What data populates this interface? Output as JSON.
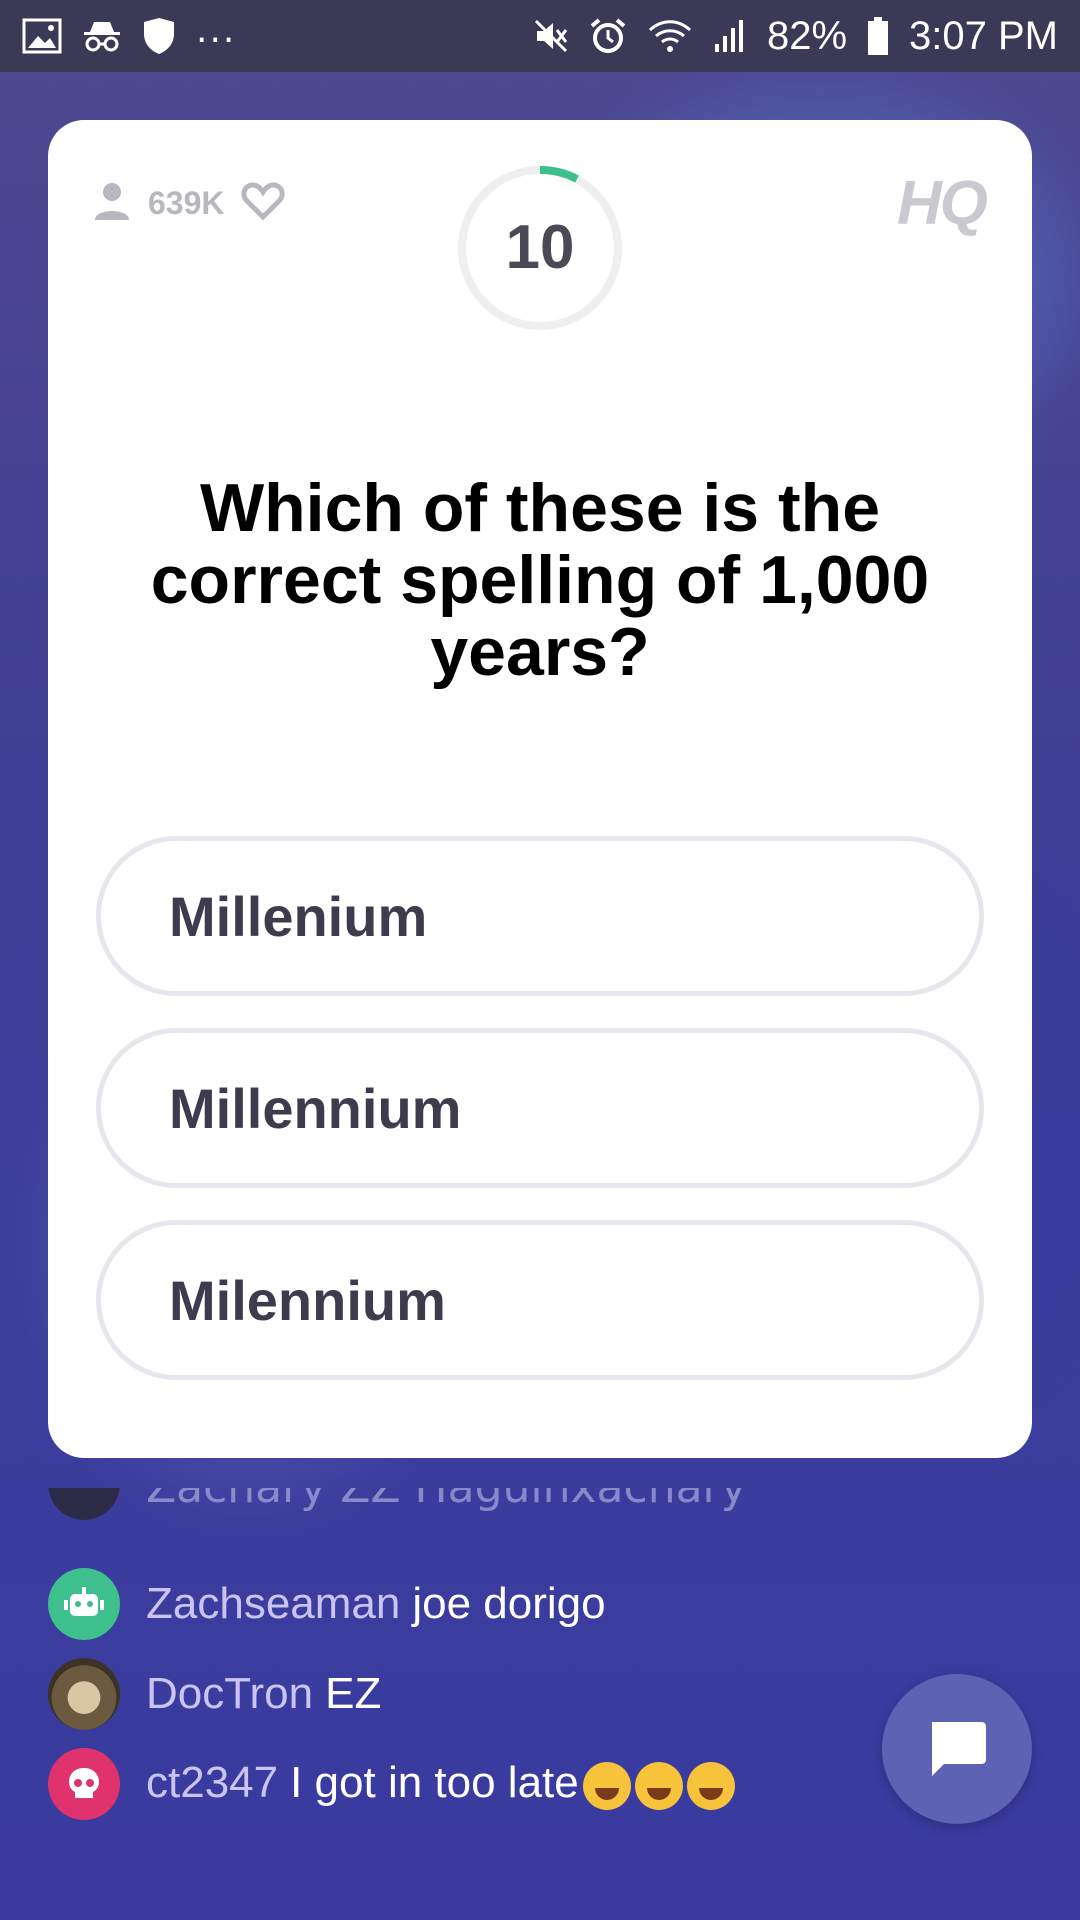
{
  "status_bar": {
    "battery": "82%",
    "time": "3:07 PM",
    "overflow": "...",
    "icons_left": [
      "image-icon",
      "incognito-icon",
      "shield-icon"
    ],
    "icons_right": [
      "mute-icon",
      "alarm-icon",
      "wifi-icon",
      "signal-icon",
      "battery-icon"
    ]
  },
  "card": {
    "viewers": "639K",
    "timer": "10",
    "logo": "HQ",
    "question": "Which of these is the correct spelling of 1,000 years?",
    "answers": [
      "Millenium",
      "Millennium",
      "Milennium"
    ],
    "timer_color": "#3ec08c"
  },
  "chat": {
    "cut_off_text": "Zachary ZZ Haguinxachary",
    "messages": [
      {
        "user": "Zachseaman",
        "text": "joe dorigo",
        "avatar": "robot-icon"
      },
      {
        "user": "DocTron",
        "text": "EZ",
        "avatar": "sloth-photo"
      },
      {
        "user": "ct2347",
        "text": "I got in too late",
        "avatar": "skull-icon",
        "emoji": "crying-laughing x3"
      }
    ]
  }
}
